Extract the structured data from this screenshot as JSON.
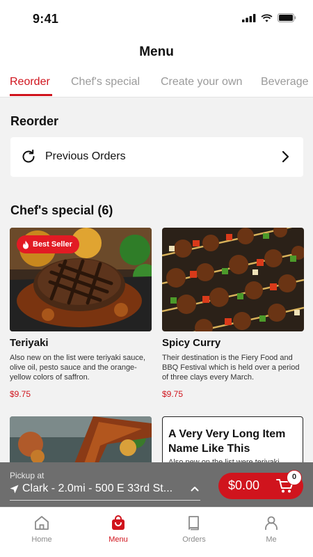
{
  "status_bar": {
    "time": "9:41"
  },
  "header": {
    "title": "Menu"
  },
  "tabs": [
    {
      "label": "Reorder",
      "active": true
    },
    {
      "label": "Chef's special",
      "active": false
    },
    {
      "label": "Create your own",
      "active": false
    },
    {
      "label": "Beverage",
      "active": false
    }
  ],
  "reorder": {
    "title": "Reorder",
    "previous_orders_label": "Previous Orders",
    "refresh_icon": "refresh-icon",
    "chevron_icon": "chevron-right-icon"
  },
  "chefs_special": {
    "title": "Chef's special (6)",
    "items": [
      {
        "name": "Teriyaki",
        "description": "Also new on the list were teriyaki sauce, olive oil, pesto sauce and the orange-yellow colors of saffron.",
        "price": "$9.75",
        "badge": "Best Seller",
        "image": "grilled-steak-photo"
      },
      {
        "name": "Spicy Curry",
        "description": "Their destination is the Fiery Food and BBQ Festival which is held over a period of three clays every March.",
        "price": "$9.75",
        "image": "kebab-skewers-photo"
      },
      {
        "image": "grilled-skewer-photo"
      },
      {
        "name": "A Very Very Long Item Name Like This",
        "description": "Also new on the list were teriyaki sauce, olive oil, pesto sauce"
      }
    ]
  },
  "pickup": {
    "label": "Pickup at",
    "location": "Clark - 2.0mi - 500 E 33rd St..."
  },
  "cart": {
    "total": "$0.00",
    "count": "0"
  },
  "bottom_nav": [
    {
      "label": "Home",
      "icon": "home-icon",
      "active": false
    },
    {
      "label": "Menu",
      "icon": "shopping-bag-icon",
      "active": true
    },
    {
      "label": "Orders",
      "icon": "book-icon",
      "active": false
    },
    {
      "label": "Me",
      "icon": "person-icon",
      "active": false
    }
  ],
  "colors": {
    "accent": "#d0141d",
    "background": "#f2f2f2",
    "pickup_bar": "#6e6e6e"
  }
}
